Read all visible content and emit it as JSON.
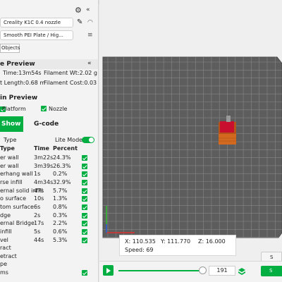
{
  "printer": {
    "name": "Creality K1C 0.4 nozzle",
    "plate": "Smooth PEI Plate / Hig..."
  },
  "objects_tab": "Objects",
  "preview": {
    "heading": "e Preview",
    "time": "Time:13m54s",
    "filament_wt": "Filament Wt:2.02 g",
    "length": "t Length:0.68 m",
    "filament_cost": "Filament Cost:0.03"
  },
  "main_preview": {
    "heading": "in Preview",
    "platform": "Platform",
    "nozzle": "Nozzle"
  },
  "tabs": {
    "show": "Show",
    "gcode": "G-code"
  },
  "line_type": {
    "label": "Type",
    "lite_mode": "Lite Mode",
    "col_type": "Type",
    "col_time": "Time",
    "col_percent": "Percent",
    "rows": [
      {
        "name": "er wall",
        "time": "3m22s",
        "percent": "24.3%",
        "checked": true
      },
      {
        "name": "er wall",
        "time": "3m39s",
        "percent": "26.3%",
        "checked": true
      },
      {
        "name": "erhang wall",
        "time": "1s",
        "percent": "0.2%",
        "checked": true
      },
      {
        "name": "rse infill",
        "time": "4m34s",
        "percent": "32.9%",
        "checked": true
      },
      {
        "name": "ernal solid infill",
        "time": "47s",
        "percent": "5.7%",
        "checked": true
      },
      {
        "name": "o surface",
        "time": "10s",
        "percent": "1.3%",
        "checked": true
      },
      {
        "name": "tom surface",
        "time": "6s",
        "percent": "0.8%",
        "checked": true
      },
      {
        "name": "dge",
        "time": "2s",
        "percent": "0.3%",
        "checked": true
      },
      {
        "name": "ernal Bridge",
        "time": "17s",
        "percent": "2.2%",
        "checked": true
      },
      {
        "name": "infill",
        "time": "5s",
        "percent": "0.6%",
        "checked": true
      },
      {
        "name": "vel",
        "time": "44s",
        "percent": "5.3%",
        "checked": true
      },
      {
        "name": "ract",
        "time": "",
        "percent": "",
        "checked": false
      },
      {
        "name": "etract",
        "time": "",
        "percent": "",
        "checked": false
      },
      {
        "name": "pe",
        "time": "",
        "percent": "",
        "checked": false
      },
      {
        "name": "ms",
        "time": "",
        "percent": "",
        "checked": true
      }
    ]
  },
  "viewport_info": {
    "x": "X: 110.535",
    "y": "Y: 111.770",
    "z": "Z: 16.000",
    "speed": "Speed: 69"
  },
  "layer_value": "191",
  "right_buttons": {
    "top": "S",
    "bottom": "S"
  },
  "colors": {
    "accent": "#00ae42",
    "bed": "#5d5d5d",
    "grid": "#8a8a8a",
    "model": "#d2691e",
    "model_top": "#c8102e"
  }
}
